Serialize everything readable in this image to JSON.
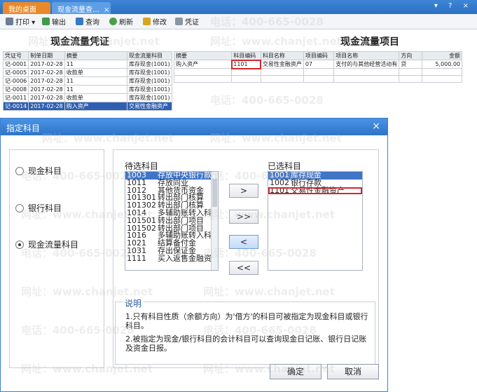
{
  "app": {
    "tabs": [
      {
        "label": "我的桌面"
      },
      {
        "label": "现金流量查…"
      }
    ],
    "tab_close": "×",
    "window_controls": "▾ ? ×"
  },
  "toolbar": {
    "print": "打印",
    "export": "输出",
    "query": "查询",
    "refresh": "刷新",
    "edit": "修改",
    "voucher": "凭证"
  },
  "left_section": {
    "title": "现金流量凭证",
    "headers": [
      "凭证号",
      "制单日期",
      "摘要",
      "现金流量科目"
    ],
    "rows": [
      [
        "记-0001",
        "2017-02-28",
        "11",
        "库存现金(1001)"
      ],
      [
        "记-0005",
        "2017-02-28",
        "收款单",
        "库存现金(1001)"
      ],
      [
        "记-0006",
        "2017-02-28",
        "11",
        "库存现金(1001)"
      ],
      [
        "记-0008",
        "2017-02-28",
        "11",
        "库存现金(1001)"
      ],
      [
        "记-0011",
        "2017-02-28",
        "收款单",
        "库存现金(1001)"
      ],
      [
        "记-0014",
        "2017-02-28",
        "购入资产",
        "交易性金融资产"
      ]
    ]
  },
  "right_section": {
    "title": "现金流量项目",
    "headers": [
      "摘要",
      "科目编码",
      "科目名称",
      "项目编码",
      "项目名称",
      "方向",
      "金额"
    ],
    "row": [
      "购入资产",
      "1101",
      "交易性金融资产",
      "07",
      "支付的与其他经营活动有",
      "贷",
      "5,000.00"
    ]
  },
  "watermarks": {
    "phone": "电话：400-665-0028",
    "site": "网址：www.chanjet.net"
  },
  "dialog": {
    "title": "指定科目",
    "close": "×",
    "radios": [
      {
        "label": "现金科目",
        "checked": false
      },
      {
        "label": "银行科目",
        "checked": false
      },
      {
        "label": "现金流量科目",
        "checked": true
      }
    ],
    "candidate_label": "待选科目",
    "candidates": [
      {
        "code": "1003",
        "name": "存放中央银行款"
      },
      {
        "code": "1011",
        "name": "存放同业"
      },
      {
        "code": "1012",
        "name": "其他货币资金"
      },
      {
        "code": "101301",
        "name": "转出部门核算"
      },
      {
        "code": "101302",
        "name": "转出部门核算"
      },
      {
        "code": "1014",
        "name": "多辅助账转入科"
      },
      {
        "code": "101501",
        "name": "转出部门项目"
      },
      {
        "code": "101502",
        "name": "转出部门项目"
      },
      {
        "code": "1016",
        "name": "多辅助账转入科"
      },
      {
        "code": "1021",
        "name": "结算备付金"
      },
      {
        "code": "1031",
        "name": "存出保证金"
      },
      {
        "code": "1111",
        "name": "买入返售金融资"
      }
    ],
    "selected_label": "已选科目",
    "selected": [
      {
        "code": "1001",
        "name": "库存现金"
      },
      {
        "code": "1002",
        "name": "银行存款"
      },
      {
        "code": "1101",
        "name": "交易性金融资产"
      }
    ],
    "move_buttons": [
      ">",
      ">>",
      "<",
      "<<"
    ],
    "desc_title": "说明",
    "desc_lines": [
      "1.只有科目性质（余额方向）为'借方'的科目可被指定为现金科目或银行科目。",
      "2.被指定为现金/银行科目的会计科目可以查询现金日记账、银行日记账及资金日报。"
    ],
    "ok": "确定",
    "cancel": "取消"
  },
  "colors": {
    "title_bar": "#2e74c9",
    "selection": "#3f74c7",
    "highlight_box": "#d8262a",
    "active_tab": "#e98a2a"
  }
}
